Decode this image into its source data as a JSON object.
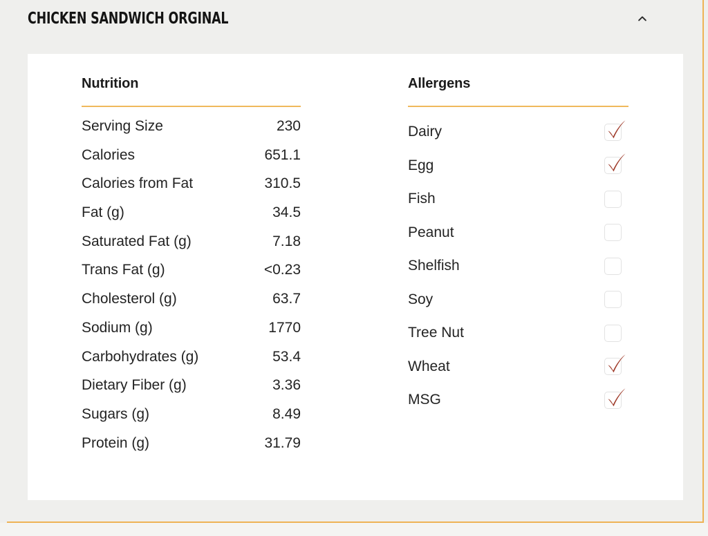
{
  "theme": {
    "page_background": "#efefed",
    "card_background": "#ffffff",
    "accent_rule": "#f0b95c",
    "frame_rule": "#eeb355",
    "check_color": "#9d3726",
    "checkbox_border": "#e2e2e2",
    "text_color": "#232323"
  },
  "header": {
    "title": "CHICKEN SANDWICH ORGINAL",
    "toggle_icon": "chevron-up-icon",
    "expanded": "true"
  },
  "nutrition": {
    "title": "Nutrition",
    "rows": [
      {
        "label": "Serving Size",
        "value": "230"
      },
      {
        "label": "Calories",
        "value": "651.1"
      },
      {
        "label": "Calories from Fat",
        "value": "310.5"
      },
      {
        "label": "Fat (g)",
        "value": "34.5"
      },
      {
        "label": "Saturated Fat (g)",
        "value": "7.18"
      },
      {
        "label": "Trans Fat (g)",
        "value": "<0.23"
      },
      {
        "label": "Cholesterol (g)",
        "value": "63.7"
      },
      {
        "label": "Sodium (g)",
        "value": "1770"
      },
      {
        "label": "Carbohydrates (g)",
        "value": "53.4"
      },
      {
        "label": "Dietary Fiber (g)",
        "value": "3.36"
      },
      {
        "label": "Sugars (g)",
        "value": "8.49"
      },
      {
        "label": "Protein (g)",
        "value": "31.79"
      }
    ]
  },
  "allergens": {
    "title": "Allergens",
    "rows": [
      {
        "label": "Dairy",
        "checked": true
      },
      {
        "label": "Egg",
        "checked": true
      },
      {
        "label": "Fish",
        "checked": false
      },
      {
        "label": "Peanut",
        "checked": false
      },
      {
        "label": "Shelfish",
        "checked": false
      },
      {
        "label": "Soy",
        "checked": false
      },
      {
        "label": "Tree Nut",
        "checked": false
      },
      {
        "label": "Wheat",
        "checked": true
      },
      {
        "label": "MSG",
        "checked": true
      }
    ]
  }
}
